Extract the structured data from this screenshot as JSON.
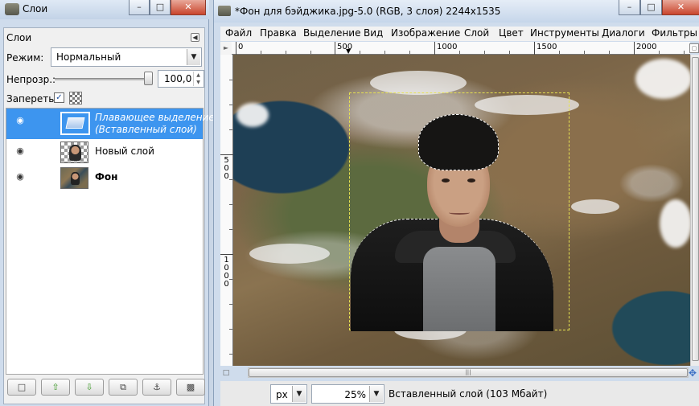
{
  "layers_window": {
    "title": "Слои",
    "dock_tab": "Слои",
    "mode_label": "Режим:",
    "mode_value": "Нормальный",
    "opacity_label": "Непрозр.:",
    "opacity_value": "100,0",
    "lock_label": "Запереть:",
    "lock_pixels_checked": true,
    "layers": [
      {
        "name_line1": "Плавающее выделение",
        "name_line2": "(Вставленный слой)",
        "selected": true,
        "visible": true
      },
      {
        "name": "Новый слой",
        "selected": false,
        "visible": true
      },
      {
        "name": "Фон",
        "selected": false,
        "visible": true
      }
    ],
    "buttons": [
      "new-layer",
      "raise-layer",
      "lower-layer",
      "duplicate-layer",
      "anchor-layer",
      "delete-layer"
    ]
  },
  "image_window": {
    "title": "*Фон для бэйджика.jpg-5.0 (RGB, 3 слоя) 2244x1535",
    "menu": [
      "Файл",
      "Правка",
      "Выделение",
      "Вид",
      "Изображение",
      "Слой",
      "Цвет",
      "Инструменты",
      "Диалоги",
      "Фильтры"
    ],
    "ruler_h_labels": [
      "0",
      "500",
      "1000",
      "1500",
      "2000"
    ],
    "ruler_v_labels": [
      "500",
      "1000"
    ],
    "unit": "px",
    "zoom": "25%",
    "status": "Вставленный слой (103 Мбайт)"
  },
  "colors": {
    "selection_highlight": "#3d95ef",
    "title_gradient_top": "#e5edf7",
    "close_button": "#c9452d"
  }
}
